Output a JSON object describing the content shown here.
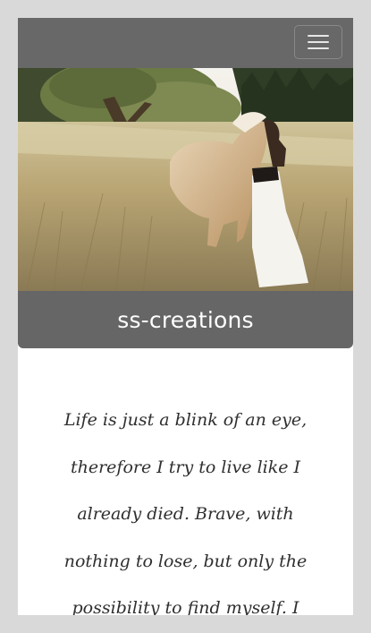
{
  "nav": {
    "menu_icon": "hamburger-menu-icon"
  },
  "hero": {
    "image": "woman-with-horse-in-meadow"
  },
  "site": {
    "title": "ss-creations"
  },
  "quote": {
    "lines": [
      "Life is just a blink of an eye,",
      "therefore I try to live like I",
      "already died. Brave, with",
      "nothing to lose, but only the",
      "possibility to find myself. I"
    ]
  },
  "colors": {
    "page_background": "#d9d9d9",
    "navbar": "#686868",
    "title_bar": "#666666",
    "content": "#ffffff",
    "text": "#2f2f2f"
  }
}
